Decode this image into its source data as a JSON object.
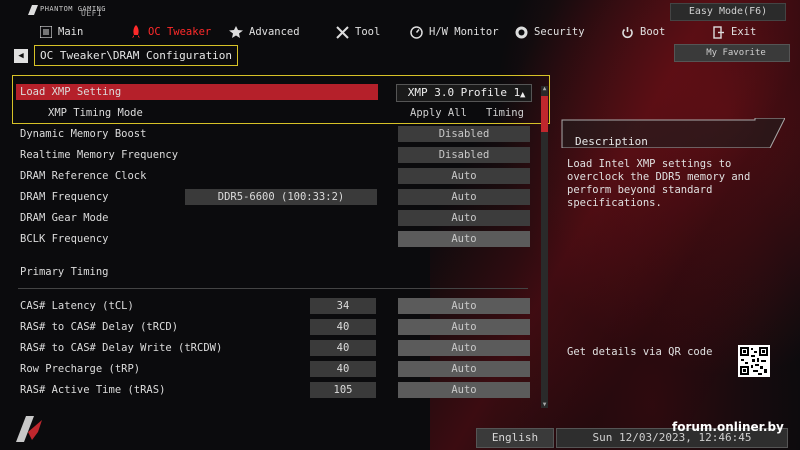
{
  "header": {
    "logo_small": "PHANTOM GAMING",
    "logo_uefi": "UEFI",
    "easy_mode": "Easy Mode(F6)",
    "my_favorite": "My Favorite"
  },
  "tabs": [
    {
      "label": "Main",
      "icon": "menu-icon",
      "active": false
    },
    {
      "label": "OC Tweaker",
      "icon": "rocket-icon",
      "active": true
    },
    {
      "label": "Advanced",
      "icon": "star-icon",
      "active": false
    },
    {
      "label": "Tool",
      "icon": "tools-icon",
      "active": false
    },
    {
      "label": "H/W Monitor",
      "icon": "monitor-icon",
      "active": false
    },
    {
      "label": "Security",
      "icon": "shield-icon",
      "active": false
    },
    {
      "label": "Boot",
      "icon": "power-icon",
      "active": false
    },
    {
      "label": "Exit",
      "icon": "exit-icon",
      "active": false
    }
  ],
  "breadcrumb": "OC Tweaker\\DRAM Configuration",
  "settings": {
    "load_xmp": {
      "label": "Load XMP Setting",
      "value": "XMP 3.0 Profile 1"
    },
    "xmp_timing": {
      "label": "XMP Timing Mode",
      "value_left": "Apply All",
      "value_right": "Timing"
    },
    "dynamic_boost": {
      "label": "Dynamic Memory Boost",
      "value": "Disabled"
    },
    "realtime_freq": {
      "label": "Realtime Memory Frequency",
      "value": "Disabled"
    },
    "ref_clock": {
      "label": "DRAM Reference Clock",
      "value": "Auto"
    },
    "dram_freq": {
      "label": "DRAM Frequency",
      "current": "DDR5-6600 (100:33:2)",
      "value": "Auto"
    },
    "gear_mode": {
      "label": "DRAM Gear Mode",
      "value": "Auto"
    },
    "bclk": {
      "label": "BCLK Frequency",
      "value": "Auto"
    }
  },
  "primary_timing": {
    "title": "Primary Timing",
    "rows": [
      {
        "label": "CAS# Latency (tCL)",
        "current": "34",
        "value": "Auto"
      },
      {
        "label": "RAS# to CAS# Delay (tRCD)",
        "current": "40",
        "value": "Auto"
      },
      {
        "label": "RAS# to CAS# Delay Write (tRCDW)",
        "current": "40",
        "value": "Auto"
      },
      {
        "label": "Row Precharge (tRP)",
        "current": "40",
        "value": "Auto"
      },
      {
        "label": "RAS# Active Time (tRAS)",
        "current": "105",
        "value": "Auto"
      }
    ]
  },
  "description": {
    "title": "Description",
    "text": "Load Intel XMP settings to overclock the DDR5 memory and perform beyond standard specifications.",
    "qr_text": "Get details via QR code"
  },
  "footer": {
    "language": "English",
    "datetime": "Sun 12/03/2023, 12:46:45",
    "watermark": "forum.onliner.by"
  },
  "colors": {
    "accent_red": "#b5202a",
    "highlight_frame": "#d7c227",
    "active_tab": "#ff2a2a"
  }
}
